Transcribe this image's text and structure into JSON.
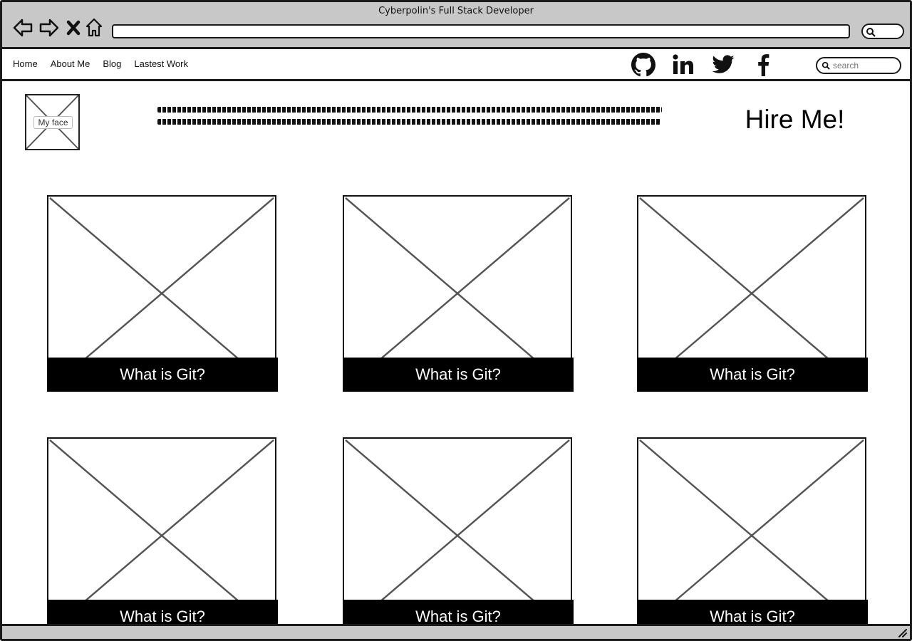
{
  "window": {
    "title": "Cyberpolin's Full Stack Developer",
    "url": ""
  },
  "toolbar_icons": [
    "back-arrow-icon",
    "forward-arrow-icon",
    "close-x-icon",
    "home-icon",
    "search-icon"
  ],
  "nav": {
    "items": [
      {
        "label": "Home"
      },
      {
        "label": "About Me"
      },
      {
        "label": "Blog"
      },
      {
        "label": "Lastest Work"
      }
    ]
  },
  "social_icons": [
    "github-icon",
    "linkedin-icon",
    "twitter-icon",
    "facebook-icon"
  ],
  "search": {
    "placeholder": "search"
  },
  "hero": {
    "avatar_label": "My face",
    "hire_label": "Hire Me!"
  },
  "cards": [
    {
      "caption": "What is Git?"
    },
    {
      "caption": "What is Git?"
    },
    {
      "caption": "What is Git?"
    },
    {
      "caption": "What is Git?"
    },
    {
      "caption": "What is Git?"
    },
    {
      "caption": "What is Git?"
    }
  ],
  "colors": {
    "chrome": "#c8c8c8",
    "border": "#1a1a1a",
    "caption_bg": "#000000",
    "caption_text": "#ffffff",
    "placeholder_x": "#555555"
  }
}
